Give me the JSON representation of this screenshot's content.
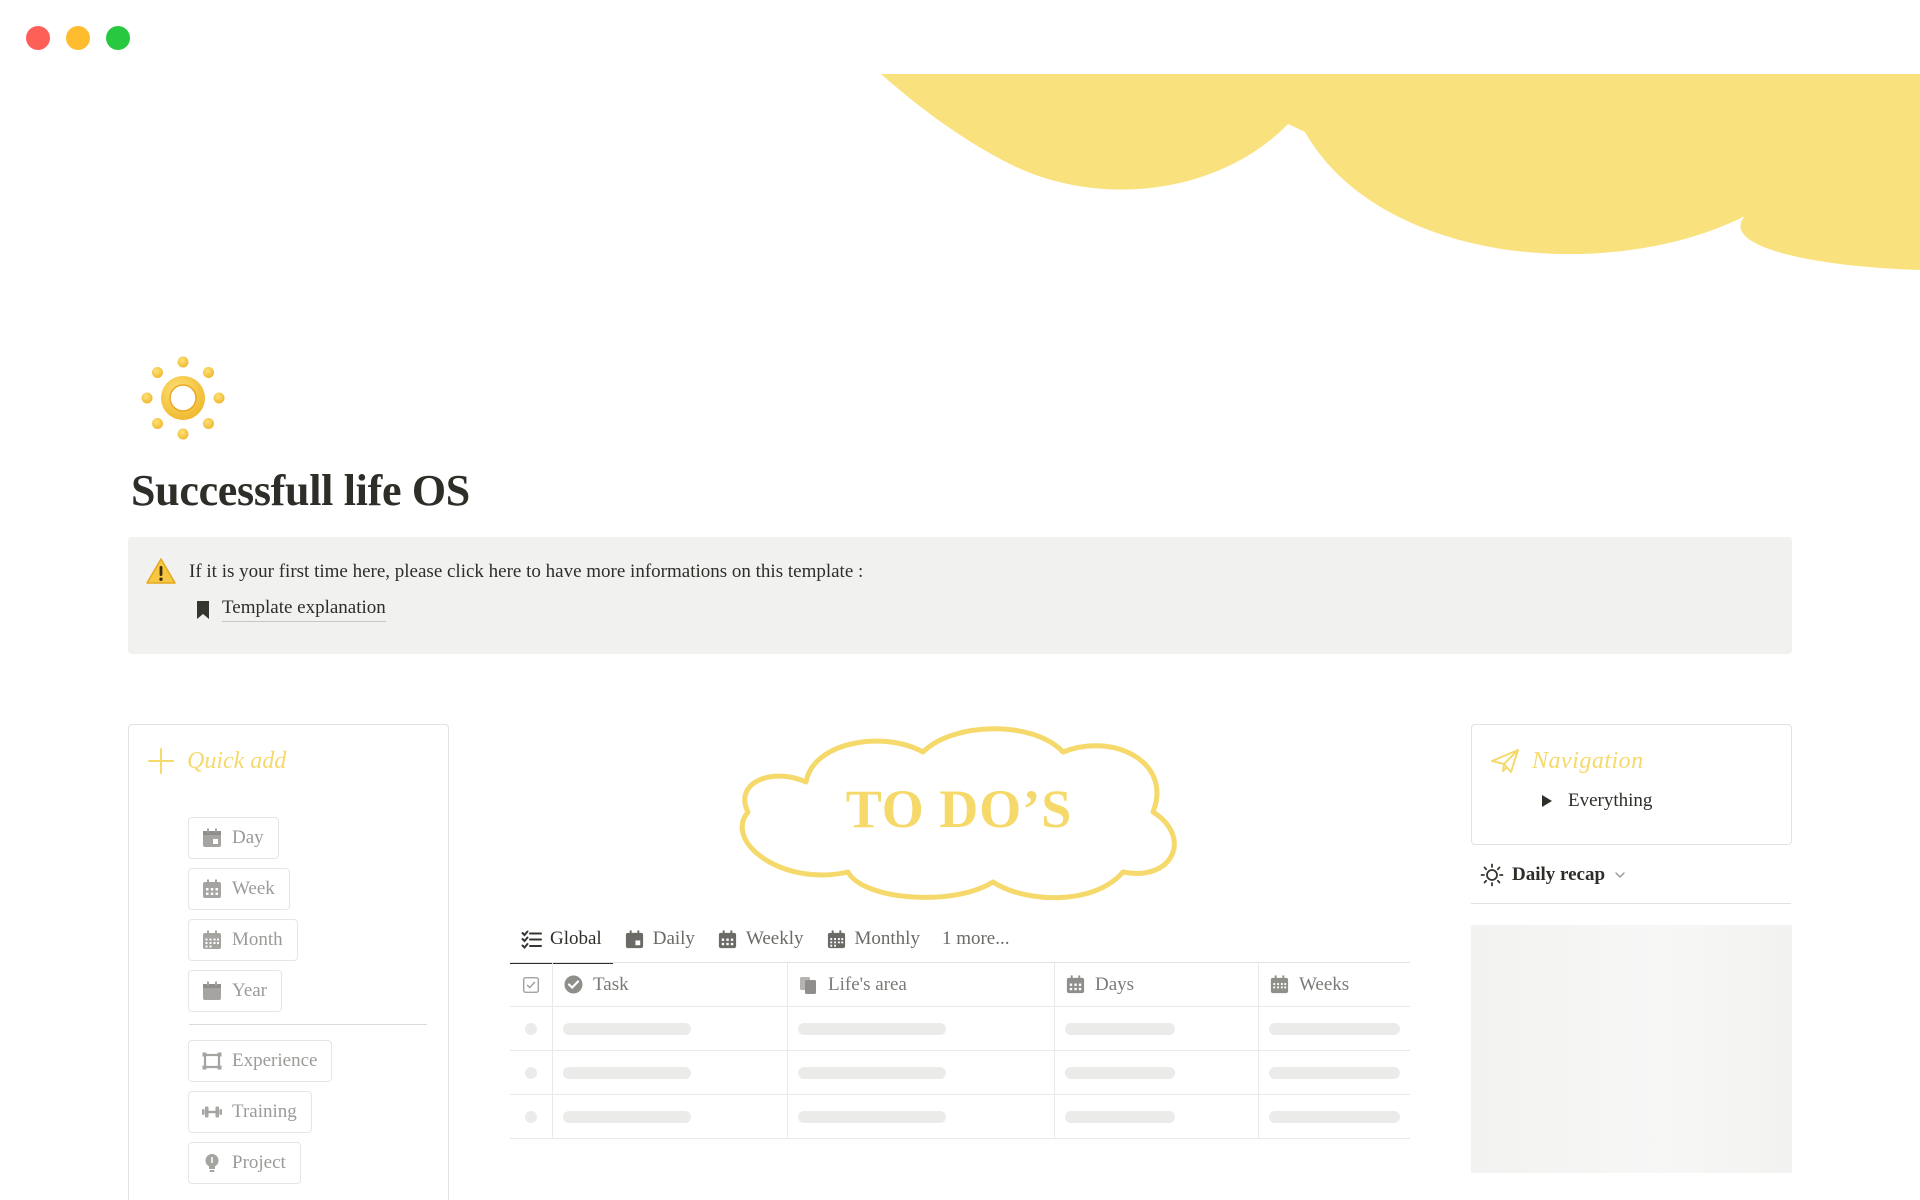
{
  "page": {
    "title": "Successfull life OS",
    "accent_color": "#f9e17d",
    "icon": "sun-icon"
  },
  "callout": {
    "icon": "warning-icon",
    "message": "If it is your first time here, please click here to have more informations on this template :",
    "link_label": "Template explanation",
    "link_icon": "bookmark-icon"
  },
  "quick_add": {
    "title": "Quick add",
    "buttons": [
      {
        "label": "Day",
        "icon": "calendar-icon"
      },
      {
        "label": "Week",
        "icon": "calendar-grid-icon"
      },
      {
        "label": "Month",
        "icon": "calendar-month-icon"
      },
      {
        "label": "Year",
        "icon": "calendar-year-icon"
      },
      {
        "label": "Experience",
        "icon": "frame-icon"
      },
      {
        "label": "Training",
        "icon": "dumbbell-icon"
      },
      {
        "label": "Project",
        "icon": "lightbulb-icon"
      }
    ]
  },
  "todo": {
    "title": "TO DO’S",
    "tabs": [
      {
        "label": "Global",
        "icon": "checklist-icon",
        "active": true
      },
      {
        "label": "Daily",
        "icon": "calendar-icon"
      },
      {
        "label": "Weekly",
        "icon": "calendar-grid-icon"
      },
      {
        "label": "Monthly",
        "icon": "calendar-month-icon"
      }
    ],
    "more_label": "1 more...",
    "columns": [
      {
        "label": "Task",
        "icon": "check-badge-icon"
      },
      {
        "label": "Life's area",
        "icon": "files-icon"
      },
      {
        "label": "Days",
        "icon": "calendar-grid-icon"
      },
      {
        "label": "Weeks",
        "icon": "calendar-grid-icon"
      }
    ]
  },
  "navigation": {
    "title": "Navigation",
    "icon": "paper-plane-icon",
    "items": [
      {
        "label": "Everything"
      }
    ]
  },
  "daily_recap": {
    "label": "Daily recap",
    "icon": "sun-outline-icon"
  }
}
